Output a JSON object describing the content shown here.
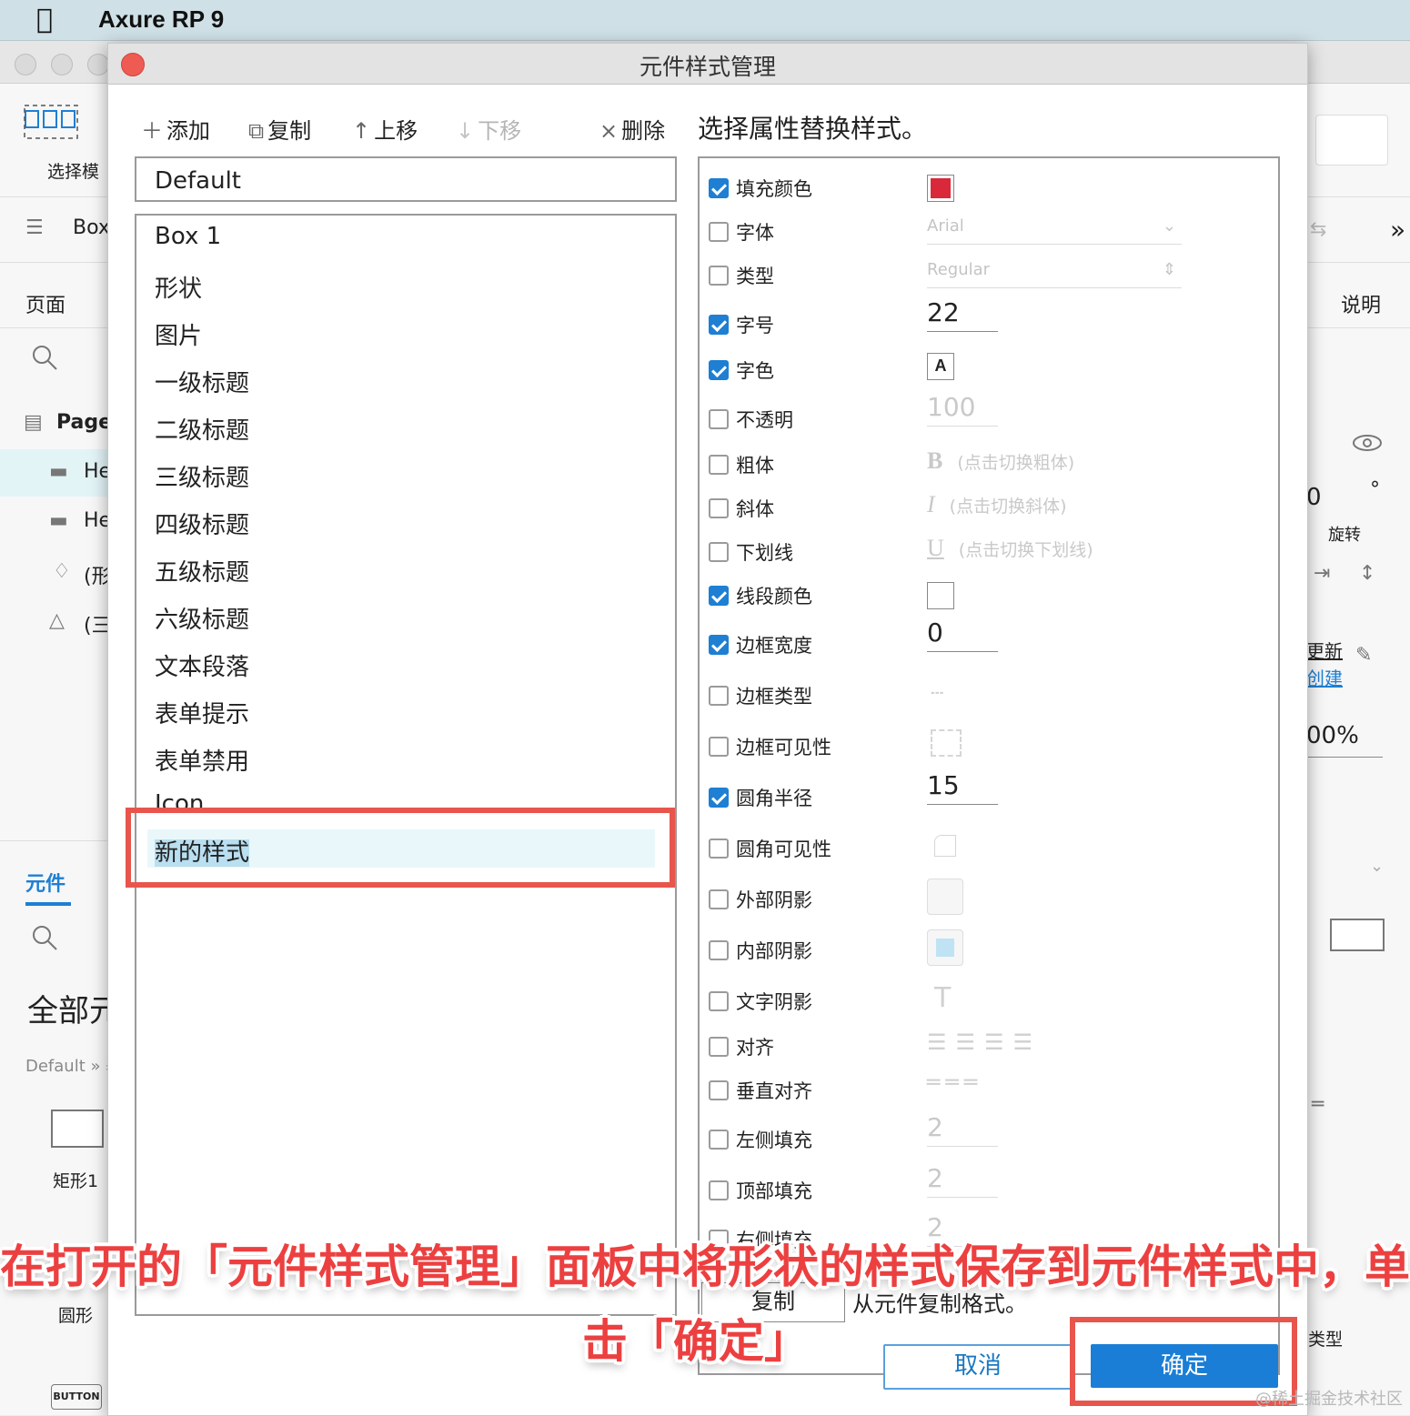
{
  "menubar": {
    "app_title": "Axure RP 9"
  },
  "background": {
    "left": {
      "select_mode": "选择模",
      "box_label": "Box",
      "pages_title": "页面",
      "page_root": "Page",
      "items": [
        "He",
        "He",
        "(形",
        "(三"
      ],
      "widgets_tab": "元件",
      "library": "全部元",
      "breadcrumb": "Default » 基",
      "rect_label": "矩形1",
      "circle_label": "圆形",
      "button_label": "BUTTON"
    },
    "right": {
      "notes_title": "说明",
      "rotate_value": "0",
      "rotate_unit": "°",
      "rotate_label": "旋转",
      "update_link": "更新",
      "create_link": "创建",
      "opacity": "00%",
      "type_label": "类型"
    }
  },
  "dialog": {
    "title": "元件样式管理",
    "toolbar": {
      "add": "添加",
      "copy": "复制",
      "move_up": "上移",
      "move_down": "下移",
      "delete": "删除"
    },
    "default_style": "Default",
    "styles": [
      "Box 1",
      "形状",
      "图片",
      "一级标题",
      "二级标题",
      "三级标题",
      "四级标题",
      "五级标题",
      "六级标题",
      "文本段落",
      "表单提示",
      "表单禁用",
      "Icon"
    ],
    "new_style": "新的样式",
    "hint": "选择属性替换样式。",
    "properties": {
      "fill_color": {
        "label": "填充颜色",
        "checked": true,
        "color": "#d9283a"
      },
      "font": {
        "label": "字体",
        "checked": false,
        "value": "Arial"
      },
      "font_type": {
        "label": "类型",
        "checked": false,
        "value": "Regular"
      },
      "font_size": {
        "label": "字号",
        "checked": true,
        "value": "22"
      },
      "font_color": {
        "label": "字色",
        "checked": true,
        "value": "A"
      },
      "opacity": {
        "label": "不透明",
        "checked": false,
        "value": "100"
      },
      "bold": {
        "label": "粗体",
        "checked": false,
        "glyph": "B",
        "text": "(点击切换粗体)"
      },
      "italic": {
        "label": "斜体",
        "checked": false,
        "glyph": "I",
        "text": "(点击切换斜体)"
      },
      "underline": {
        "label": "下划线",
        "checked": false,
        "glyph": "U",
        "text": "(点击切换下划线)"
      },
      "line_color": {
        "label": "线段颜色",
        "checked": true,
        "color": "#ffffff"
      },
      "border_width": {
        "label": "边框宽度",
        "checked": true,
        "value": "0"
      },
      "border_type": {
        "label": "边框类型",
        "checked": false
      },
      "border_visibility": {
        "label": "边框可见性",
        "checked": false
      },
      "corner_radius": {
        "label": "圆角半径",
        "checked": true,
        "value": "15"
      },
      "corner_visibility": {
        "label": "圆角可见性",
        "checked": false
      },
      "outer_shadow": {
        "label": "外部阴影",
        "checked": false
      },
      "inner_shadow": {
        "label": "内部阴影",
        "checked": false
      },
      "text_shadow": {
        "label": "文字阴影",
        "checked": false
      },
      "align": {
        "label": "对齐",
        "checked": false
      },
      "valign": {
        "label": "垂直对齐",
        "checked": false
      },
      "padding_left": {
        "label": "左侧填充",
        "checked": false,
        "value": "2"
      },
      "padding_top": {
        "label": "顶部填充",
        "checked": false,
        "value": "2"
      },
      "padding_right": {
        "label": "右侧填充",
        "checked": false,
        "value": "2"
      }
    },
    "copy_button": "复制",
    "copy_hint": "从元件复制格式。",
    "cancel": "取消",
    "ok": "确定"
  },
  "caption": {
    "line1": "在打开的「元件样式管理」面板中将形状的样式保存到元件样式中，单",
    "line2": "击「确定」"
  },
  "watermark": "@稀土掘金技术社区",
  "colors": {
    "accent": "#1a7ed6",
    "highlight": "#e8554c",
    "caption": "#ec4040"
  }
}
